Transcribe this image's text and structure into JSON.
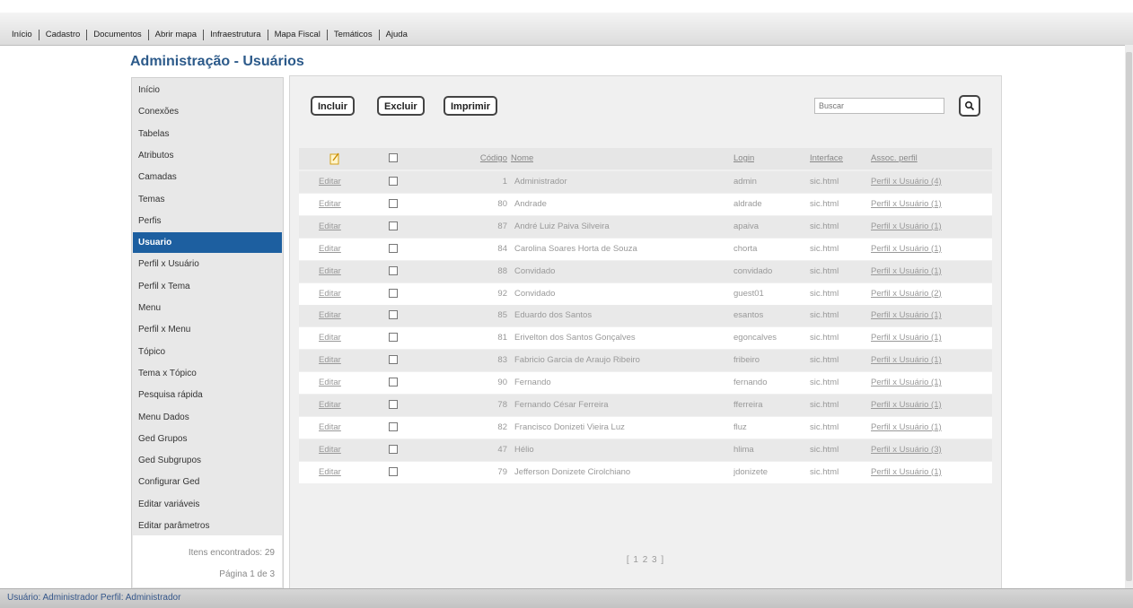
{
  "menu": [
    "Início",
    "Cadastro",
    "Documentos",
    "Abrir mapa",
    "Infraestrutura",
    "Mapa Fiscal",
    "Temáticos",
    "Ajuda"
  ],
  "page_title": "Administração - Usuários",
  "sidebar": {
    "items": [
      "Início",
      "Conexões",
      "Tabelas",
      "Atributos",
      "Camadas",
      "Temas",
      "Perfis",
      "Usuario",
      "Perfil x Usuário",
      "Perfil x Tema",
      "Menu",
      "Perfil x Menu",
      "Tópico",
      "Tema x Tópico",
      "Pesquisa rápida",
      "Menu Dados",
      "Ged Grupos",
      "Ged Subgrupos",
      "Configurar Ged",
      "Editar variáveis",
      "Editar parâmetros"
    ],
    "active": "Usuario",
    "count_text": "Itens encontrados: 29",
    "page_text": "Página 1 de 3"
  },
  "toolbar": {
    "incluir": "Incluir",
    "excluir": "Excluir",
    "imprimir": "Imprimir"
  },
  "search": {
    "placeholder": "Buscar"
  },
  "table": {
    "headers": {
      "codigo": "Código",
      "nome": "Nome",
      "login": "Login",
      "interface": "Interface",
      "perfil": "Assoc. perfil"
    },
    "edit_label": "Editar",
    "rows": [
      {
        "codigo": "1",
        "nome": "Administrador",
        "login": "admin",
        "interface": "sic.html",
        "perfil": "Perfil x Usuário (4)"
      },
      {
        "codigo": "80",
        "nome": "Andrade",
        "login": "aldrade",
        "interface": "sic.html",
        "perfil": "Perfil x Usuário (1)"
      },
      {
        "codigo": "87",
        "nome": "André Luiz Paiva Silveira",
        "login": "apaiva",
        "interface": "sic.html",
        "perfil": "Perfil x Usuário (1)"
      },
      {
        "codigo": "84",
        "nome": "Carolina Soares Horta de Souza",
        "login": "chorta",
        "interface": "sic.html",
        "perfil": "Perfil x Usuário (1)"
      },
      {
        "codigo": "88",
        "nome": "Convidado",
        "login": "convidado",
        "interface": "sic.html",
        "perfil": "Perfil x Usuário (1)"
      },
      {
        "codigo": "92",
        "nome": "Convidado",
        "login": "guest01",
        "interface": "sic.html",
        "perfil": "Perfil x Usuário (2)"
      },
      {
        "codigo": "85",
        "nome": "Eduardo dos Santos",
        "login": "esantos",
        "interface": "sic.html",
        "perfil": "Perfil x Usuário (1)"
      },
      {
        "codigo": "81",
        "nome": "Erivelton dos Santos Gonçalves",
        "login": "egoncalves",
        "interface": "sic.html",
        "perfil": "Perfil x Usuário (1)"
      },
      {
        "codigo": "83",
        "nome": "Fabricio Garcia de Araujo Ribeiro",
        "login": "fribeiro",
        "interface": "sic.html",
        "perfil": "Perfil x Usuário (1)"
      },
      {
        "codigo": "90",
        "nome": "Fernando",
        "login": "fernando",
        "interface": "sic.html",
        "perfil": "Perfil x Usuário (1)"
      },
      {
        "codigo": "78",
        "nome": "Fernando César Ferreira",
        "login": "fferreira",
        "interface": "sic.html",
        "perfil": "Perfil x Usuário (1)"
      },
      {
        "codigo": "82",
        "nome": "Francisco Donizeti Vieira Luz",
        "login": "fluz",
        "interface": "sic.html",
        "perfil": "Perfil x Usuário (1)"
      },
      {
        "codigo": "47",
        "nome": "Hélio",
        "login": "hlima",
        "interface": "sic.html",
        "perfil": "Perfil x Usuário (3)"
      },
      {
        "codigo": "79",
        "nome": "Jefferson Donizete Cirolchiano",
        "login": "jdonizete",
        "interface": "sic.html",
        "perfil": "Perfil x Usuário (1)"
      }
    ]
  },
  "pager": "[ 1 2 3 ]",
  "status_text": "Usuário: Administrador Perfil: Administrador"
}
